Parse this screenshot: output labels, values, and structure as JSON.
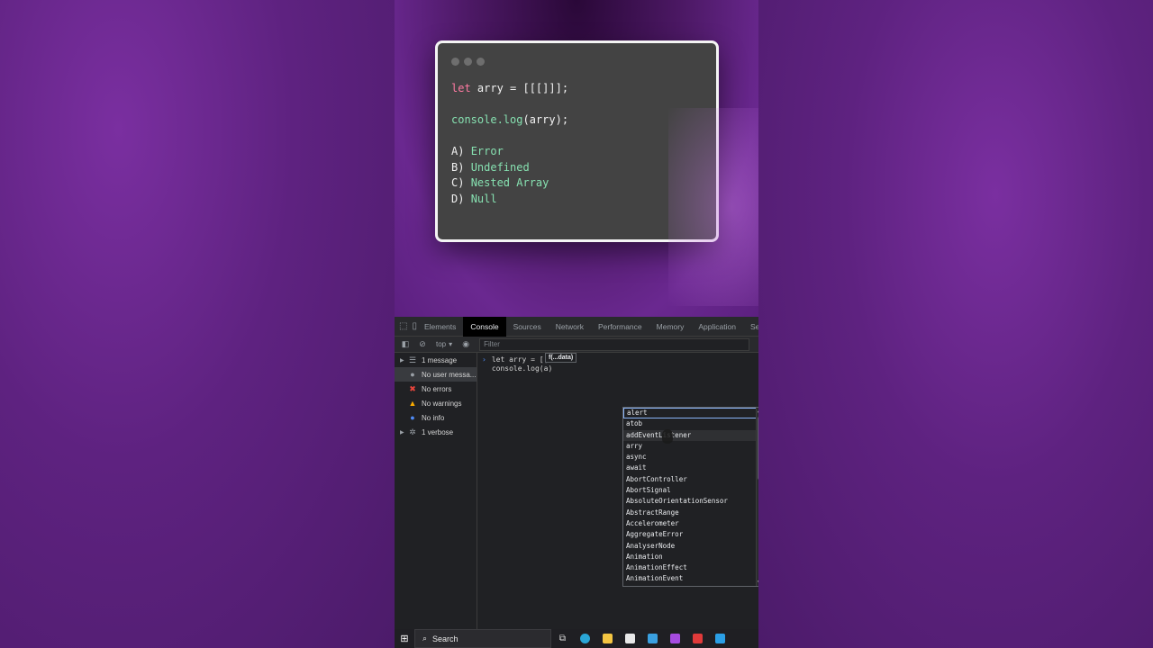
{
  "quiz": {
    "line1": {
      "keyword": "let",
      "rest": " arry = [[[]]];"
    },
    "line2": {
      "fn": "console.log",
      "rest": "(arry);"
    },
    "options": [
      {
        "letter": "A)",
        "text": "Error"
      },
      {
        "letter": "B)",
        "text": "Undefined"
      },
      {
        "letter": "C)",
        "text": "Nested Array"
      },
      {
        "letter": "D)",
        "text": "Null"
      }
    ]
  },
  "devtools": {
    "tabs": [
      "Elements",
      "Console",
      "Sources",
      "Network",
      "Performance",
      "Memory",
      "Application",
      "Se"
    ],
    "active_tab": "Console",
    "context": "top",
    "filter_placeholder": "Filter",
    "sidebar": [
      {
        "label": "1 message",
        "icon": "list-icon",
        "expandable": true
      },
      {
        "label": "No user messa...",
        "icon": "user-icon",
        "expandable": false
      },
      {
        "label": "No errors",
        "icon": "error-icon",
        "expandable": false
      },
      {
        "label": "No warnings",
        "icon": "warning-icon",
        "expandable": false
      },
      {
        "label": "No info",
        "icon": "info-icon",
        "expandable": false
      },
      {
        "label": "1 verbose",
        "icon": "gear-icon",
        "expandable": true
      }
    ],
    "console_lines": [
      "let arry = [[",
      "console.log(a)"
    ],
    "signature_hint": "f(...data)",
    "autocomplete": [
      "alert",
      "atob",
      "addEventListener",
      "arry",
      "async",
      "await",
      "AbortController",
      "AbortSignal",
      "AbsoluteOrientationSensor",
      "AbstractRange",
      "Accelerometer",
      "AggregateError",
      "AnalyserNode",
      "Animation",
      "AnimationEffect",
      "AnimationEvent"
    ],
    "autocomplete_selected": "alert"
  },
  "taskbar": {
    "search_label": "Search"
  },
  "colors": {
    "keyword": "#ff7aa2",
    "function": "#86e0b0",
    "card_bg": "#434343",
    "devtools_bg": "#202124"
  }
}
